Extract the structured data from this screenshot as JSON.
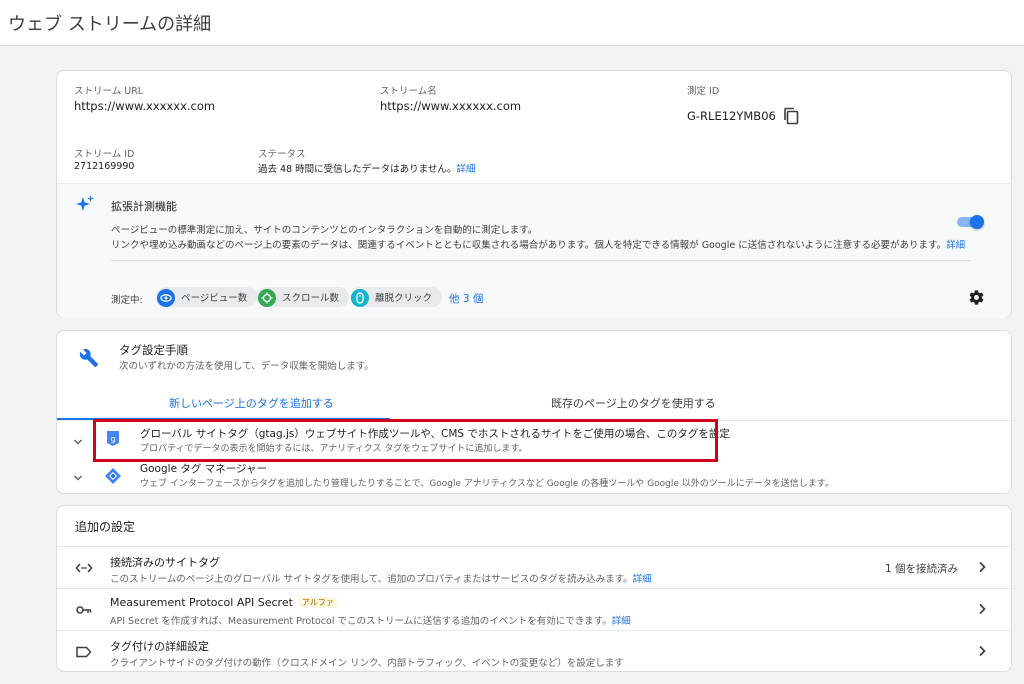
{
  "page_title": "ウェブ ストリームの詳細",
  "details": {
    "stream_url_label": "ストリーム URL",
    "stream_url_value": "https://www.xxxxxx.com",
    "stream_name_label": "ストリーム名",
    "stream_name_value": "https://www.xxxxxx.com",
    "measurement_id_label": "測定 ID",
    "measurement_id_value": "G-RLE12YMB06",
    "stream_id_label": "ストリーム ID",
    "stream_id_value": "2712169990",
    "status_label": "ステータス",
    "status_value": "過去 48 時間に受信したデータはありません。",
    "status_link": "詳細"
  },
  "enhanced": {
    "title": "拡張計測機能",
    "desc1": "ページビューの標準測定に加え、サイトのコンテンツとのインタラクションを自動的に測定します。",
    "desc2": "リンクや埋め込み動画などのページ上の要素のデータは、関連するイベントとともに収集される場合があります。個人を特定できる情報が Google に送信されないように注意する必要があります。",
    "desc2_link": "詳細",
    "toggle_on": true,
    "measuring_label": "測定中:",
    "chips": [
      {
        "label": "ページビュー数",
        "icon": "eye-icon"
      },
      {
        "label": "スクロール数",
        "icon": "crosshair-icon"
      },
      {
        "label": "離脱クリック",
        "icon": "mouse-icon"
      }
    ],
    "more_link": "他 3 個"
  },
  "tag_setup": {
    "title": "タグ設定手順",
    "subtitle": "次のいずれかの方法を使用して、データ収集を開始します。",
    "tabs": [
      {
        "label": "新しいページ上のタグを追加する",
        "active": true
      },
      {
        "label": "既存のページ上のタグを使用する",
        "active": false
      }
    ],
    "options": [
      {
        "title": "グローバル サイトタグ（gtag.js）ウェブサイト作成ツールや、CMS でホストされるサイトをご使用の場合、このタグを設定",
        "desc": "プロパティでデータの表示を開始するには、アナリティクス タグをウェブサイトに追加します。",
        "icon": "gtag-icon",
        "highlighted": true
      },
      {
        "title": "Google タグ マネージャー",
        "desc": "ウェブ インターフェースからタグを追加したり管理したりすることで、Google アナリティクスなど Google の各種ツールや Google 以外のツールにデータを送信します。",
        "icon": "tag-manager-icon",
        "highlighted": false
      }
    ]
  },
  "additional": {
    "title": "追加の設定",
    "rows": [
      {
        "title": "接続済みのサイトタグ",
        "desc": "このストリームのページ上のグローバル サイトタグを使用して、追加のプロパティまたはサービスのタグを読み込みます。",
        "link": "詳細",
        "status": "1 個を接続済み",
        "icon": "code-icon"
      },
      {
        "title": "Measurement Protocol API Secret",
        "badge": "アルファ",
        "desc": "API Secret を作成すれば、Measurement Protocol でこのストリームに送信する追加のイベントを有効にできます。",
        "link": "詳細",
        "icon": "key-icon"
      },
      {
        "title": "タグ付けの詳細設定",
        "desc": "クライアントサイドのタグ付けの動作（クロスドメイン リンク、内部トラフィック、イベントの変更など）を設定します",
        "icon": "label-icon"
      }
    ]
  },
  "colors": {
    "accent": "#1a73e8",
    "highlight_border": "#d0021b",
    "background": "#f1f3f4"
  }
}
